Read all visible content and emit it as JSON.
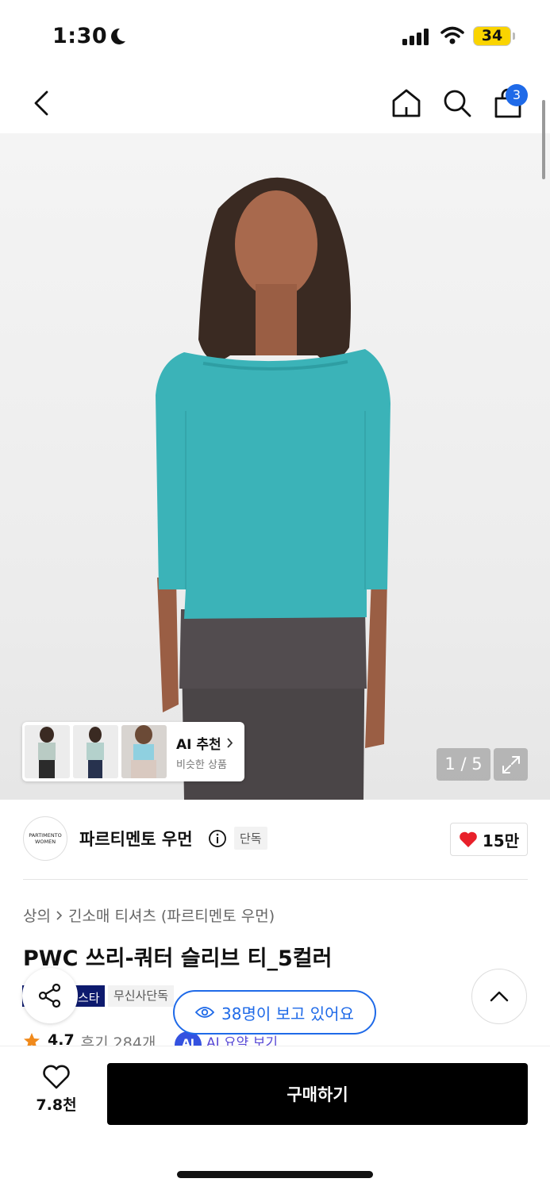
{
  "status_bar": {
    "time": "1:30",
    "battery": "34"
  },
  "nav": {
    "cart_count": "3"
  },
  "gallery": {
    "page_indicator": "1 / 5",
    "ai_rec_title": "AI 추천",
    "ai_rec_subtitle": "비슷한 상품"
  },
  "brand": {
    "logo_text": "PARTIMENTO WOMEN",
    "name": "파르티멘토 우먼",
    "tag": "단독",
    "likes": "15만"
  },
  "breadcrumb": {
    "category": "상의",
    "subcategory": "긴소매 티셔츠 (파르티멘토 우먼)"
  },
  "product": {
    "title": "PWC 쓰리-쿼터 슬리브 티_5컬러",
    "tag_star": "스타",
    "tag_exclusive": "무신사단독",
    "viewers": "38명이 보고 있어요",
    "rating": "4.7",
    "reviews": "후기 284개",
    "ai_summary_chip": "AI",
    "ai_summary": "AI 요약 보기"
  },
  "bottom": {
    "wish_count": "7.8천",
    "buy_label": "구매하기"
  },
  "colors": {
    "accent_blue": "#1f6ae8",
    "heart_red": "#e8202a",
    "star_orange": "#f08a1c",
    "shirt_teal": "#3bb3b8"
  }
}
